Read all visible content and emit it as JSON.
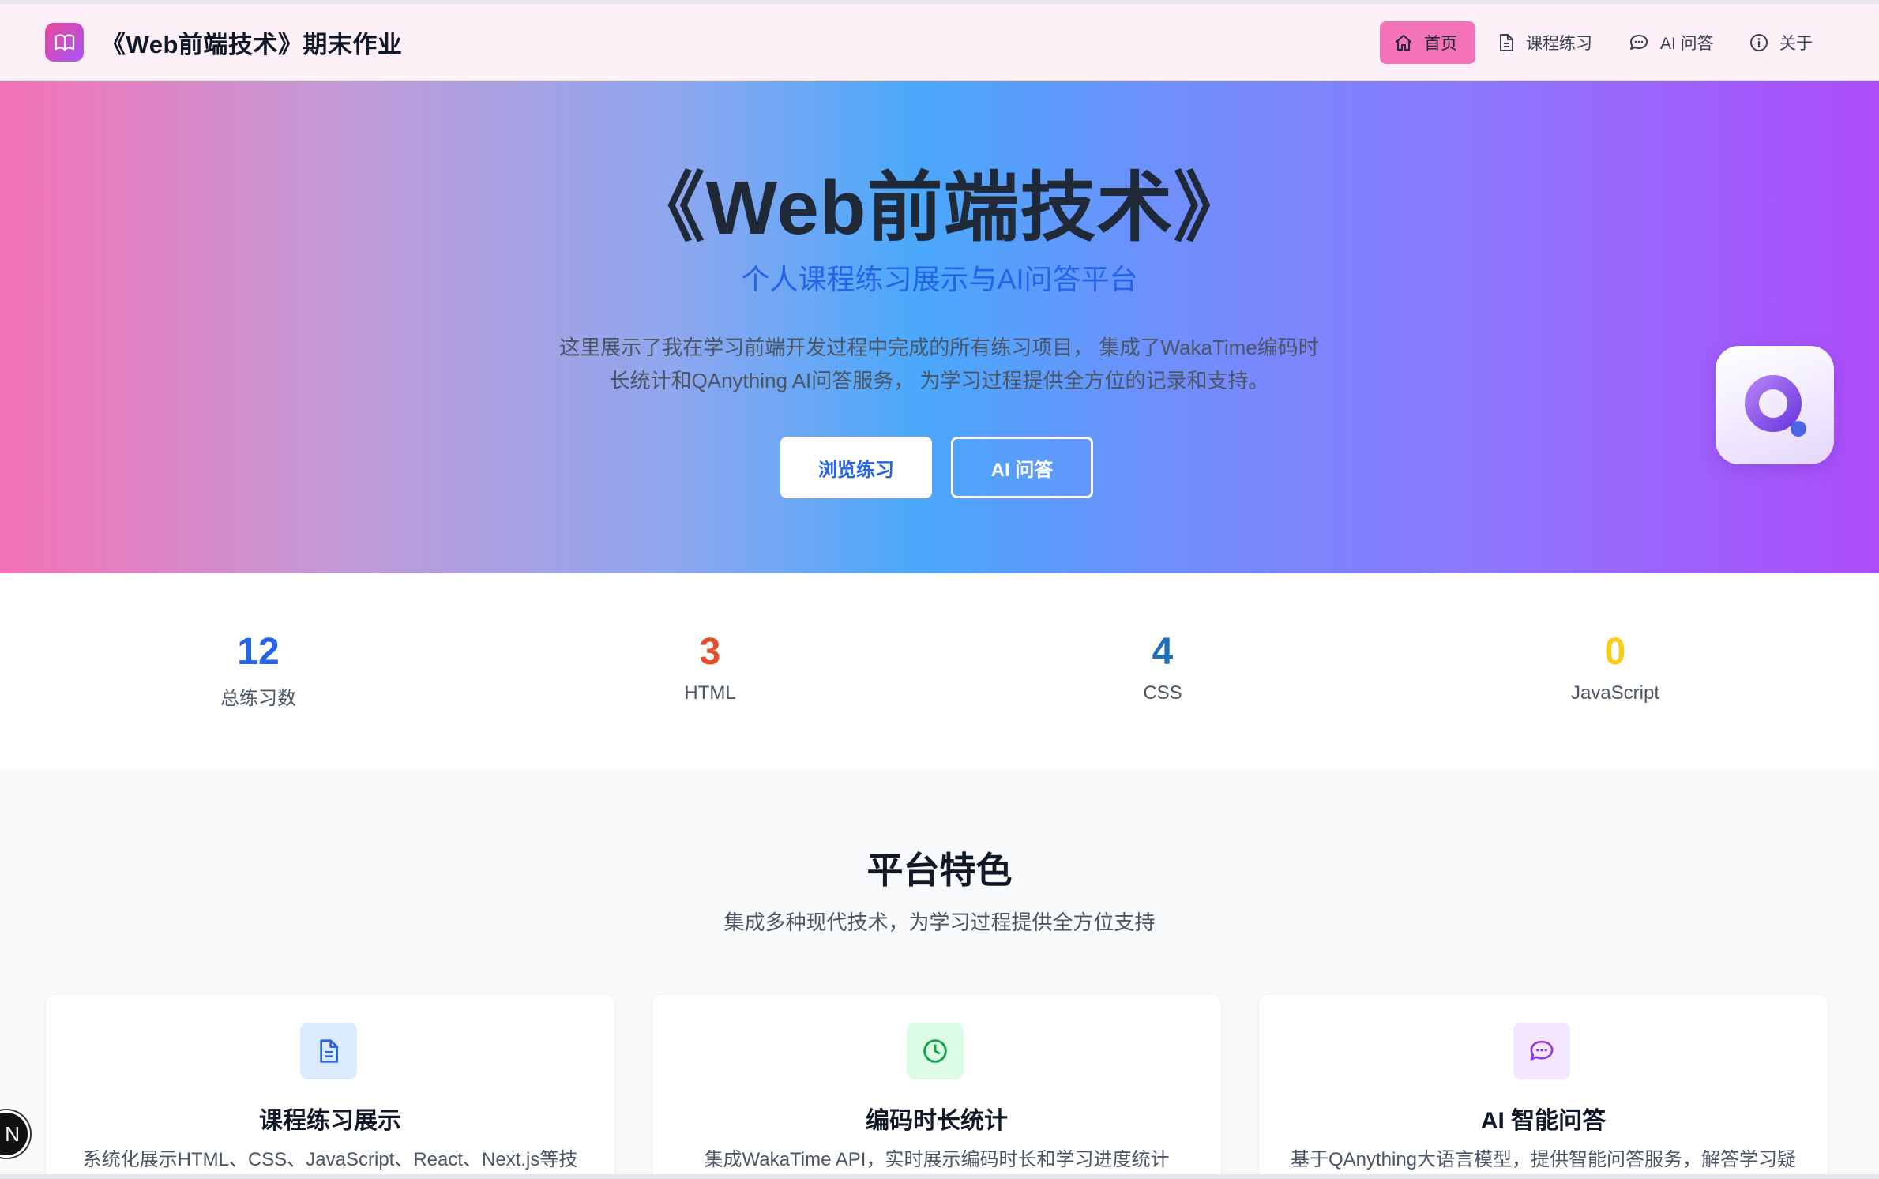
{
  "header": {
    "brand_title": "《Web前端技术》期末作业",
    "nav": [
      {
        "label": "首页",
        "icon": "home-icon",
        "active": true
      },
      {
        "label": "课程练习",
        "icon": "document-icon",
        "active": false
      },
      {
        "label": "AI 问答",
        "icon": "chat-icon",
        "active": false
      },
      {
        "label": "关于",
        "icon": "info-icon",
        "active": false
      }
    ]
  },
  "hero": {
    "title": "《Web前端技术》",
    "subtitle": "个人课程练习展示与AI问答平台",
    "description_line1": "这里展示了我在学习前端开发过程中完成的所有练习项目， 集成了WakaTime编码时",
    "description_line2": "长统计和QAnything AI问答服务， 为学习过程提供全方位的记录和支持。",
    "primary_button": "浏览练习",
    "secondary_button": "AI 问答"
  },
  "stats": [
    {
      "value": "12",
      "label": "总练习数",
      "color": "#2563eb"
    },
    {
      "value": "3",
      "label": "HTML",
      "color": "#e34f26"
    },
    {
      "value": "4",
      "label": "CSS",
      "color": "#1d6fb8"
    },
    {
      "value": "0",
      "label": "JavaScript",
      "color": "#facc15"
    }
  ],
  "features": {
    "title": "平台特色",
    "subtitle": "集成多种现代技术，为学习过程提供全方位支持",
    "cards": [
      {
        "title": "课程练习展示",
        "text": "系统化展示HTML、CSS、JavaScript、React、Next.js等技",
        "icon": "document-icon",
        "icon_bg": "#dbeafe",
        "icon_color": "#2563eb"
      },
      {
        "title": "编码时长统计",
        "text": "集成WakaTime API，实时展示编码时长和学习进度统计",
        "icon": "clock-icon",
        "icon_bg": "#dcfce7",
        "icon_color": "#16a34a"
      },
      {
        "title": "AI 智能问答",
        "text": "基于QAnything大语言模型，提供智能问答服务，解答学习疑",
        "icon": "chat-icon",
        "icon_bg": "#f3e8ff",
        "icon_color": "#9333ea"
      }
    ]
  },
  "floating_badge": "N"
}
